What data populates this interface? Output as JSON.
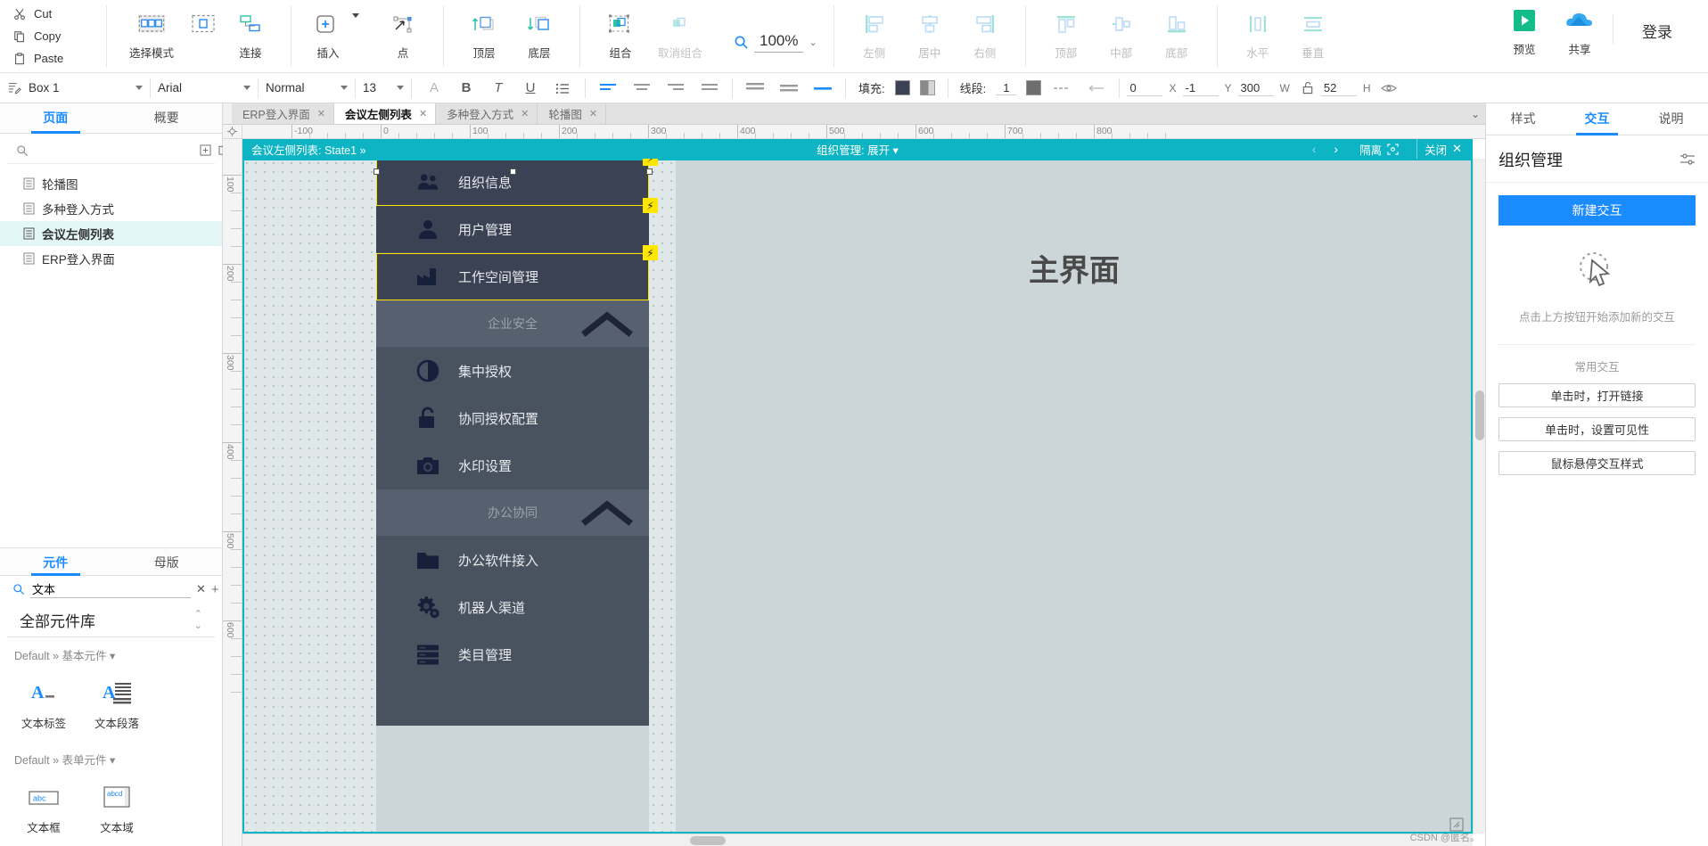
{
  "toolbar": {
    "clipboard": [
      {
        "label": "Cut",
        "icon": "scissors-icon"
      },
      {
        "label": "Copy",
        "icon": "copy-icon"
      },
      {
        "label": "Paste",
        "icon": "clipboard-icon"
      }
    ],
    "buttons": [
      {
        "label": "选择模式",
        "icon": "select-mode-icon",
        "disabled": false
      },
      {
        "label": "连接",
        "icon": "connect-icon",
        "disabled": false
      },
      {
        "label": "插入",
        "icon": "insert-icon",
        "disabled": false
      },
      {
        "label": "点",
        "icon": "point-icon",
        "disabled": false
      },
      {
        "label": "顶层",
        "icon": "bring-front-icon",
        "disabled": false
      },
      {
        "label": "底层",
        "icon": "send-back-icon",
        "disabled": false
      },
      {
        "label": "组合",
        "icon": "group-icon",
        "disabled": false
      },
      {
        "label": "取消组合",
        "icon": "ungroup-icon",
        "disabled": true
      }
    ],
    "zoom": "100%",
    "align_buttons": [
      {
        "label": "左侧",
        "icon": "align-left-icon"
      },
      {
        "label": "居中",
        "icon": "align-center-icon"
      },
      {
        "label": "右侧",
        "icon": "align-right-icon"
      },
      {
        "label": "顶部",
        "icon": "align-top-icon"
      },
      {
        "label": "中部",
        "icon": "align-middle-icon"
      },
      {
        "label": "底部",
        "icon": "align-bottom-icon"
      },
      {
        "label": "水平",
        "icon": "distribute-horizontal-icon"
      },
      {
        "label": "垂直",
        "icon": "distribute-vertical-icon"
      }
    ],
    "preview_label": "预览",
    "share_label": "共享",
    "login_label": "登录"
  },
  "format_bar": {
    "shape_name": "Box 1",
    "font_family": "Arial",
    "font_style": "Normal",
    "font_size": "13",
    "text_buttons": [
      "font-color-icon",
      "bold-icon",
      "italic-icon",
      "underline-icon",
      "bullet-list-icon"
    ],
    "align_buttons": [
      "text-align-left-icon",
      "text-align-center-icon",
      "text-align-right-icon",
      "text-align-justify-icon"
    ],
    "valign_buttons": [
      "valign-top-icon",
      "valign-middle-icon",
      "valign-bottom-icon"
    ],
    "fill_label": "填充:",
    "fill_color": "#3a4254",
    "fill_gradient_color": "#8a8a8a",
    "line_label": "线段:",
    "line_width": "1",
    "line_color": "#6e6e6e",
    "x_value": "0",
    "x_label": "X",
    "y_value": "-1",
    "y_label": "Y",
    "w_value": "300",
    "w_label": "W",
    "h_value": "52",
    "h_label": "H",
    "visibility_icon": "eye-icon",
    "lock_icon": "lock-open-icon"
  },
  "left_panel": {
    "tabs": [
      {
        "label": "页面",
        "active": true
      },
      {
        "label": "概要",
        "active": false
      }
    ],
    "search_placeholder": "",
    "search_value": "",
    "toolbar_icons": [
      "add-page-icon",
      "add-folder-icon"
    ],
    "pages": [
      {
        "label": "轮播图",
        "active": false
      },
      {
        "label": "多种登入方式",
        "active": false
      },
      {
        "label": "会议左侧列表",
        "active": true
      },
      {
        "label": "ERP登入界面",
        "active": false
      }
    ],
    "library": {
      "tabs": [
        {
          "label": "元件",
          "active": true
        },
        {
          "label": "母版",
          "active": false
        }
      ],
      "search_value": "文本",
      "title": "全部元件库",
      "groups": [
        {
          "label": "Default » 基本元件 ▾",
          "widgets": [
            {
              "label": "文本标签",
              "icon": "text-label-icon"
            },
            {
              "label": "文本段落",
              "icon": "text-paragraph-icon"
            }
          ]
        },
        {
          "label": "Default » 表单元件 ▾",
          "widgets": [
            {
              "label": "文本框",
              "icon": "textbox-icon"
            },
            {
              "label": "文本域",
              "icon": "textarea-icon"
            }
          ]
        }
      ]
    }
  },
  "canvas": {
    "tabs": [
      {
        "label": "ERP登入界面",
        "active": false
      },
      {
        "label": "会议左侧列表",
        "active": true
      },
      {
        "label": "多种登入方式",
        "active": false
      },
      {
        "label": "轮播图",
        "active": false
      }
    ],
    "ruler_h_labels": [
      "-100",
      "0",
      "100",
      "200",
      "300",
      "400",
      "500",
      "600",
      "700",
      "800"
    ],
    "ruler_v_labels": [
      "100",
      "200",
      "300",
      "400",
      "500",
      "600"
    ],
    "state_bar": {
      "left_label": "会议左侧列表: State1  »",
      "center_label": "组织管理: 展开 ▾",
      "isolate_label": "隔离",
      "close_label": "关闭",
      "prev_icon": "chevron-left-icon",
      "next_icon": "chevron-right-icon",
      "focus_icon": "focus-target-icon",
      "close_icon": "close-icon"
    },
    "menu_items": [
      {
        "label": "组织信息",
        "icon": "people-group-icon",
        "type": "item",
        "selected": true,
        "bolt": true
      },
      {
        "label": "用户管理",
        "icon": "person-icon",
        "type": "item",
        "selected": false,
        "bolt": true
      },
      {
        "label": "工作空间管理",
        "icon": "factory-icon",
        "type": "item",
        "selected": true,
        "bolt": true
      },
      {
        "label": "企业安全",
        "icon": "chevron-up-icon",
        "type": "group",
        "selected": false,
        "bolt": false
      },
      {
        "label": "集中授权",
        "icon": "contrast-circle-icon",
        "type": "item",
        "selected": false,
        "bolt": false
      },
      {
        "label": "协同授权配置",
        "icon": "unlock-icon",
        "type": "item",
        "selected": false,
        "bolt": false
      },
      {
        "label": "水印设置",
        "icon": "camera-icon",
        "type": "item",
        "selected": false,
        "bolt": false
      },
      {
        "label": "办公协同",
        "icon": "chevron-up-icon",
        "type": "group",
        "selected": false,
        "bolt": false
      },
      {
        "label": "办公软件接入",
        "icon": "folder-icon",
        "type": "item",
        "selected": false,
        "bolt": false
      },
      {
        "label": "机器人渠道",
        "icon": "gears-icon",
        "type": "item",
        "selected": false,
        "bolt": false
      },
      {
        "label": "类目管理",
        "icon": "server-icon",
        "type": "item",
        "selected": false,
        "bolt": false
      }
    ],
    "main_area_title": "主界面"
  },
  "right_panel": {
    "tabs": [
      {
        "label": "样式",
        "active": false
      },
      {
        "label": "交互",
        "active": true
      },
      {
        "label": "说明",
        "active": false
      }
    ],
    "title": "组织管理",
    "settings_icon": "sliders-icon",
    "new_interaction_label": "新建交互",
    "empty_icon": "cursor-click-icon",
    "empty_hint": "点击上方按钮开始添加新的交互",
    "common_title": "常用交互",
    "common_actions": [
      "单击时，打开链接",
      "单击时，设置可见性",
      "鼠标悬停交互样式"
    ]
  },
  "watermark": "CSDN @匿名。",
  "colors": {
    "accent_cyan": "#0cb4c4",
    "accent_blue": "#1a8cff",
    "menu_dark": "#3a4254",
    "menu_group": "#56606e",
    "canvas_bg": "#ccd6d8"
  }
}
